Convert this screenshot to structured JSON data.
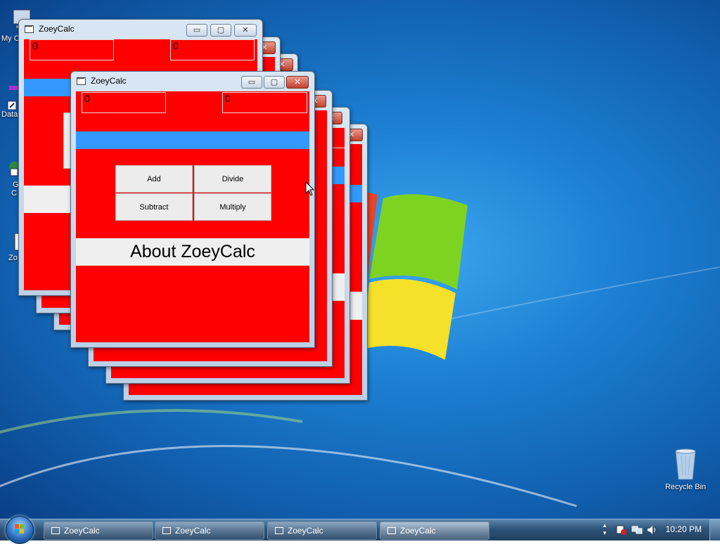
{
  "desktop": {
    "icons": [
      {
        "label": "My C"
      },
      {
        "label": "Data"
      },
      {
        "label": "G"
      },
      {
        "label": "C"
      },
      {
        "label": "Zo"
      }
    ],
    "recycle_bin": {
      "label": "Recycle Bin"
    }
  },
  "app": {
    "title": "ZoeyCalc",
    "field1_value": "0",
    "field2_value": "0",
    "buttons": {
      "add": "Add",
      "divide": "Divide",
      "subtract": "Subtract",
      "multiply": "Multiply"
    },
    "about_label": "About ZoeyCalc",
    "title_controls": {
      "minimize": "▭",
      "maximize": "▢",
      "close": "✕"
    }
  },
  "colors": {
    "client_bg": "#ff0000",
    "accent_bar": "#3399ff",
    "button_bg": "#ececec"
  },
  "taskbar": {
    "items": [
      {
        "label": "ZoeyCalc"
      },
      {
        "label": "ZoeyCalc"
      },
      {
        "label": "ZoeyCalc"
      },
      {
        "label": "ZoeyCalc"
      }
    ],
    "clock": "10:20 PM"
  }
}
